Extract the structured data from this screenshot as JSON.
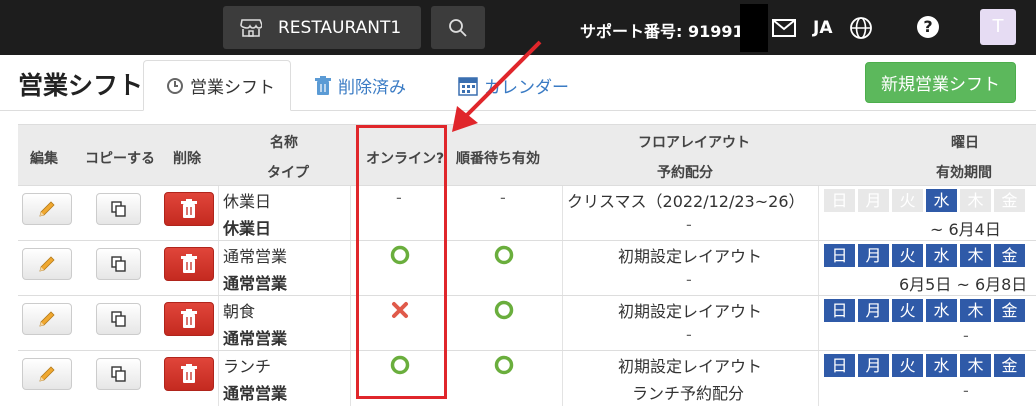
{
  "topbar": {
    "restaurant_label": "RESTAURANT1",
    "support_label": "サポート番号: 919919",
    "lang_label": "JA",
    "help_label": "?",
    "avatar_initial": "T"
  },
  "page": {
    "title": "営業シフト",
    "tabs": [
      {
        "label": "営業シフト",
        "active": true,
        "icon": "clock-icon"
      },
      {
        "label": "削除済み",
        "active": false,
        "icon": "trash-icon"
      },
      {
        "label": "カレンダー",
        "active": false,
        "icon": "calendar-icon"
      }
    ],
    "new_button_label": "新規営業シフト"
  },
  "table": {
    "headers": {
      "edit": "編集",
      "copy": "コピーする",
      "delete": "削除",
      "name": "名称",
      "type": "タイプ",
      "online": "オンライン?",
      "queue": "順番待ち有効",
      "layout": "フロアレイアウト",
      "allocation": "予約配分",
      "weekday": "曜日",
      "period": "有効期間"
    },
    "weekday_labels": [
      "日",
      "月",
      "火",
      "水",
      "木",
      "金"
    ],
    "rows": [
      {
        "name": "休業日",
        "type": "休業日",
        "online": "-",
        "queue": "-",
        "layout": "クリスマス（2022/12/23~26）",
        "allocation": "-",
        "days_active": [
          false,
          false,
          false,
          true,
          false,
          false
        ],
        "period": "~ 6月4日"
      },
      {
        "name": "通常営業",
        "type": "通常営業",
        "online": "circle",
        "queue": "circle",
        "layout": "初期設定レイアウト",
        "allocation": "-",
        "days_active": [
          true,
          true,
          true,
          true,
          true,
          true
        ],
        "period": "6月5日 ~ 6月8日"
      },
      {
        "name": "朝食",
        "type": "通常営業",
        "online": "cross",
        "queue": "circle",
        "layout": "初期設定レイアウト",
        "allocation": "-",
        "days_active": [
          true,
          true,
          true,
          true,
          true,
          true
        ],
        "period": "-"
      },
      {
        "name": "ランチ",
        "type": "通常営業",
        "online": "circle",
        "queue": "circle",
        "layout": "初期設定レイアウト",
        "allocation": "ランチ予約配分",
        "days_active": [
          true,
          true,
          true,
          true,
          true,
          true
        ],
        "period": "-"
      }
    ]
  },
  "colors": {
    "topbar": "#1d1d1d",
    "new_button": "#5cb85c",
    "delete_button": "#d9382e",
    "day_active": "#2f5aa8",
    "highlight": "#e0262b",
    "circle": "#6aae3d",
    "cross": "#e05a4a"
  }
}
